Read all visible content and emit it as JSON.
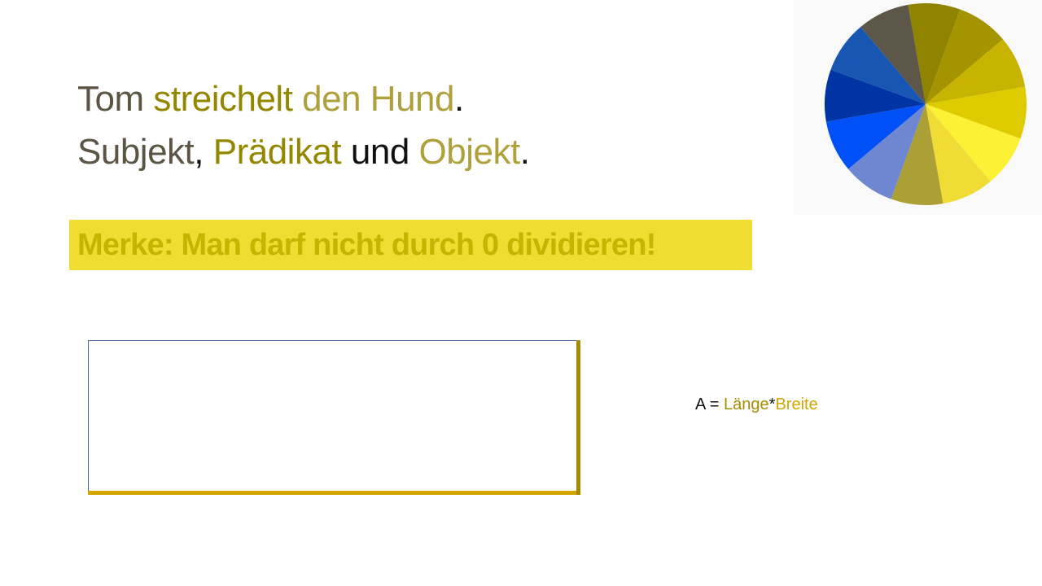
{
  "colors": {
    "subjekt": "#5d5543",
    "praedikat": "#948700",
    "objekt": "#aea03b",
    "punct": "#111111",
    "banner_bg": "#f0dd32",
    "banner_text": "#c8b400",
    "length": "#a58b00",
    "width": "#d3a400"
  },
  "sentence": {
    "subject": "Tom",
    "predicate": "streichelt",
    "object": "den Hund",
    "period": "."
  },
  "terms": {
    "subject": "Subjekt",
    "comma": ",",
    "predicate": "Prädikat",
    "and": "und",
    "object": "Objekt",
    "period": "."
  },
  "merke": {
    "label": "Merke:",
    "text": "Man darf nicht durch 0 dividieren!"
  },
  "formula": {
    "lhs": "A =",
    "length": "Länge",
    "operator": "*",
    "width": "Breite"
  },
  "color_wheel": {
    "segments": [
      "#8f8300",
      "#a39400",
      "#c8b400",
      "#decc00",
      "#fcf134",
      "#f0dc34",
      "#aba036",
      "#6f86d1",
      "#0050f8",
      "#0033a4",
      "#1856b4",
      "#5d5749"
    ]
  }
}
